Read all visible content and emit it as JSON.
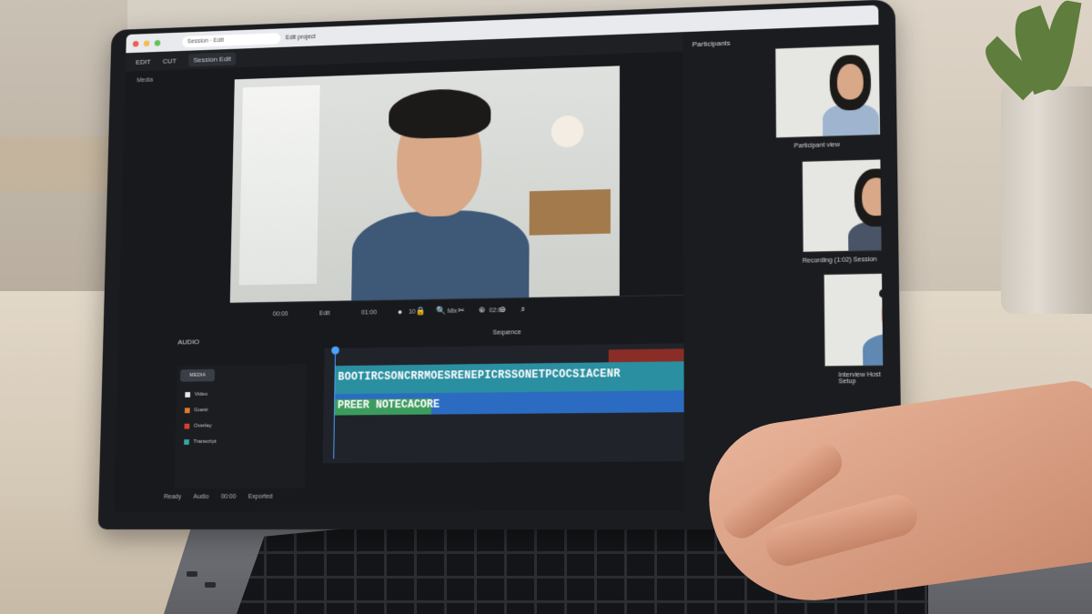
{
  "browser": {
    "tab_title": "Edit project",
    "address": "Session · Edit"
  },
  "editor": {
    "top_tabs": [
      "EDIT",
      "CUT",
      "Session Edit"
    ],
    "side_label": "Media",
    "ruler_labels": [
      "00:00",
      "Edit",
      "01:00",
      "10",
      "Mix",
      "02:00"
    ],
    "panel_title": "AUDIO",
    "timeline_title": "Sequence",
    "track_header_button": "MEDIA",
    "tracks": [
      {
        "name": "Video",
        "color": "#e8e8e8"
      },
      {
        "name": "Guest",
        "color": "#e07a2e"
      },
      {
        "name": "Overlay",
        "color": "#d6402e"
      },
      {
        "name": "Transcript",
        "color": "#39a5a5"
      }
    ],
    "clip_caption_1": "BOOTIRCSONCRRMOESRENEPICRSSONETPCOCSIACENR",
    "clip_caption_2": "PREER NOTECACORE",
    "status_items": [
      "Ready",
      "Audio",
      "00:00",
      "Exported"
    ]
  },
  "sidebar": {
    "header": "Participants",
    "participants": [
      {
        "label": "Participant view"
      },
      {
        "label": "Recording (1:02) Session"
      },
      {
        "label": "Interview Host Setup"
      }
    ]
  },
  "accent_colors": {
    "playhead": "#4aa3ff",
    "clip_teal": "#2a8fa0",
    "clip_blue": "#2c6bc2",
    "clip_red": "#8a2d26"
  }
}
